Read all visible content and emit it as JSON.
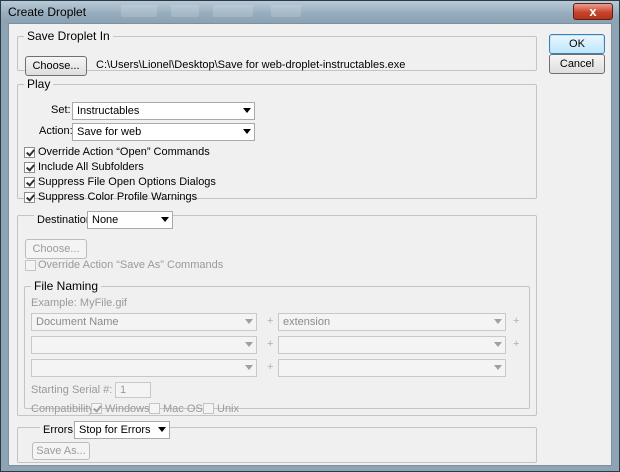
{
  "window": {
    "title": "Create Droplet",
    "close_label": "x"
  },
  "buttons": {
    "ok": "OK",
    "cancel": "Cancel"
  },
  "save_droplet": {
    "legend": "Save Droplet In",
    "choose_label": "Choose...",
    "path": "C:\\Users\\Lionel\\Desktop\\Save for web-droplet-instructables.exe"
  },
  "play": {
    "legend": "Play",
    "set_label": "Set:",
    "set_value": "Instructables",
    "action_label": "Action:",
    "action_value": "Save for web",
    "options": [
      {
        "label": "Override Action “Open” Commands",
        "checked": true
      },
      {
        "label": "Include All Subfolders",
        "checked": true
      },
      {
        "label": "Suppress File Open Options Dialogs",
        "checked": true
      },
      {
        "label": "Suppress Color Profile Warnings",
        "checked": true
      }
    ]
  },
  "destination": {
    "label": "Destination:",
    "value": "None",
    "choose_label": "Choose...",
    "override_label": "Override Action “Save As” Commands",
    "override_checked": false
  },
  "file_naming": {
    "legend": "File Naming",
    "example": "Example: MyFile.gif",
    "row1_left": "Document Name",
    "row1_right": "extension",
    "plus": "+",
    "serial_label": "Starting Serial #:",
    "serial_value": "1",
    "compat_label": "Compatibility:",
    "compat_windows": "Windows",
    "compat_mac": "Mac OS",
    "compat_unix": "Unix",
    "windows_checked": true,
    "mac_checked": false,
    "unix_checked": false
  },
  "errors": {
    "label": "Errors:",
    "value": "Stop for Errors",
    "save_as_label": "Save As..."
  }
}
